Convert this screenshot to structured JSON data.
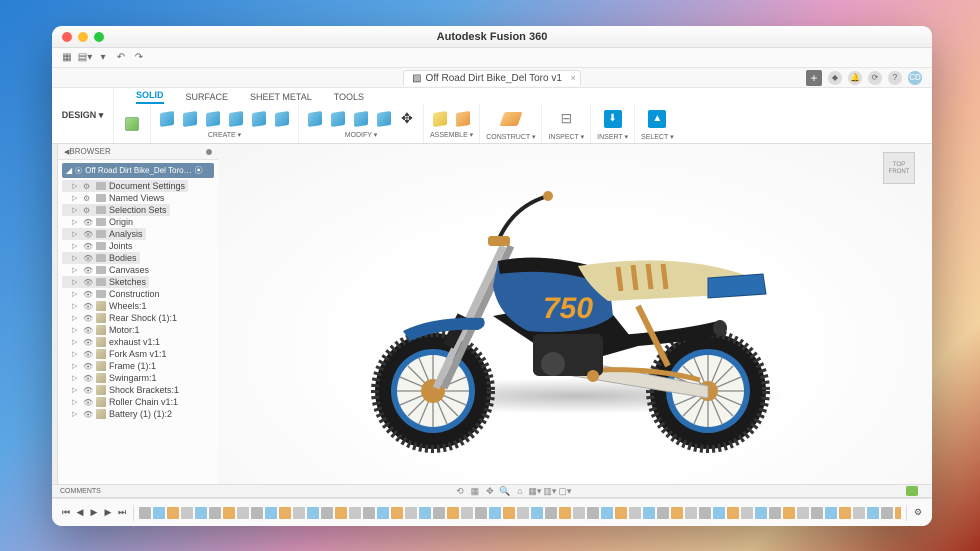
{
  "window": {
    "title": "Autodesk Fusion 360"
  },
  "document": {
    "tab_label": "Off Road Dirt Bike_Del Toro v1",
    "user_badge": "CD"
  },
  "workspace_button": "DESIGN ▾",
  "ribbon": {
    "tabs": [
      "SOLID",
      "SURFACE",
      "SHEET METAL",
      "TOOLS"
    ],
    "active_tab": "SOLID",
    "groups": [
      {
        "label": "CREATE ▾"
      },
      {
        "label": "MODIFY ▾"
      },
      {
        "label": "ASSEMBLE ▾"
      },
      {
        "label": "CONSTRUCT ▾"
      },
      {
        "label": "INSPECT ▾"
      },
      {
        "label": "INSERT ▾"
      },
      {
        "label": "SELECT ▾"
      }
    ]
  },
  "browser": {
    "header": "BROWSER",
    "root": "Off Road Dirt Bike_Del Toro…",
    "folders": [
      "Document Settings",
      "Named Views",
      "Selection Sets",
      "Origin",
      "Analysis",
      "Joints",
      "Bodies",
      "Canvases",
      "Sketches",
      "Construction"
    ],
    "components": [
      "Wheels:1",
      "Rear Shock (1):1",
      "Motor:1",
      "exhaust v1:1",
      "Fork Asm v1:1",
      "Frame (1):1",
      "Swingarm:1",
      "Shock Brackets:1",
      "Roller Chain v1:1",
      "Battery (1) (1):2"
    ]
  },
  "viewcube": {
    "top": "TOP",
    "front": "FRONT"
  },
  "comments_label": "COMMENTS",
  "model_decal": "750"
}
